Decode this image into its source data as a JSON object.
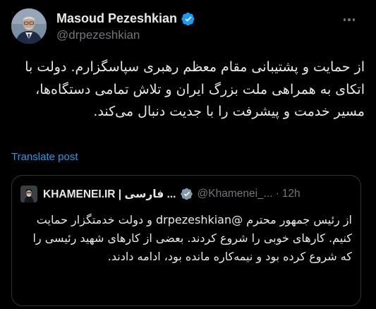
{
  "author": {
    "display_name": "Masoud Pezeshkian",
    "handle": "@drpezeshkian",
    "verified_icon": "verified-badge-icon",
    "verified_color": "#1d9bf0"
  },
  "more_icon": "more-horizontal-icon",
  "tweet_text": "از حمایت و پشتیبانی مقام معظم رهبری سپاسگزارم. دولت با اتکای به همراهی ملت بزرگ ایران و تلاش تمامی دستگاه‌ها، مسیر خدمت و پیشرفت را با جدیت دنبال می‌کند.",
  "translate_label": "Translate post",
  "quoted": {
    "display_name": "KHAMENEI.IR | فارسی ...",
    "verified_icon": "verified-badge-icon",
    "verified_color": "#829aab",
    "handle": "@Khamenei_...",
    "separator": "·",
    "time": "12h",
    "text": "از رئیس جمهور محترم @drpezeshkian و دولت خدمتگزار حمایت کنیم. کارهای خوبی را شروع کردند. بعضی از کارهای شهید رئیسی را که شروع کرده بود و نیمه‌کاره مانده بود، ادامه دادند."
  },
  "colors": {
    "background": "#000000",
    "text": "#e7e9ea",
    "secondary": "#71767b",
    "link": "#1d9bf0",
    "border": "#2f3336"
  }
}
